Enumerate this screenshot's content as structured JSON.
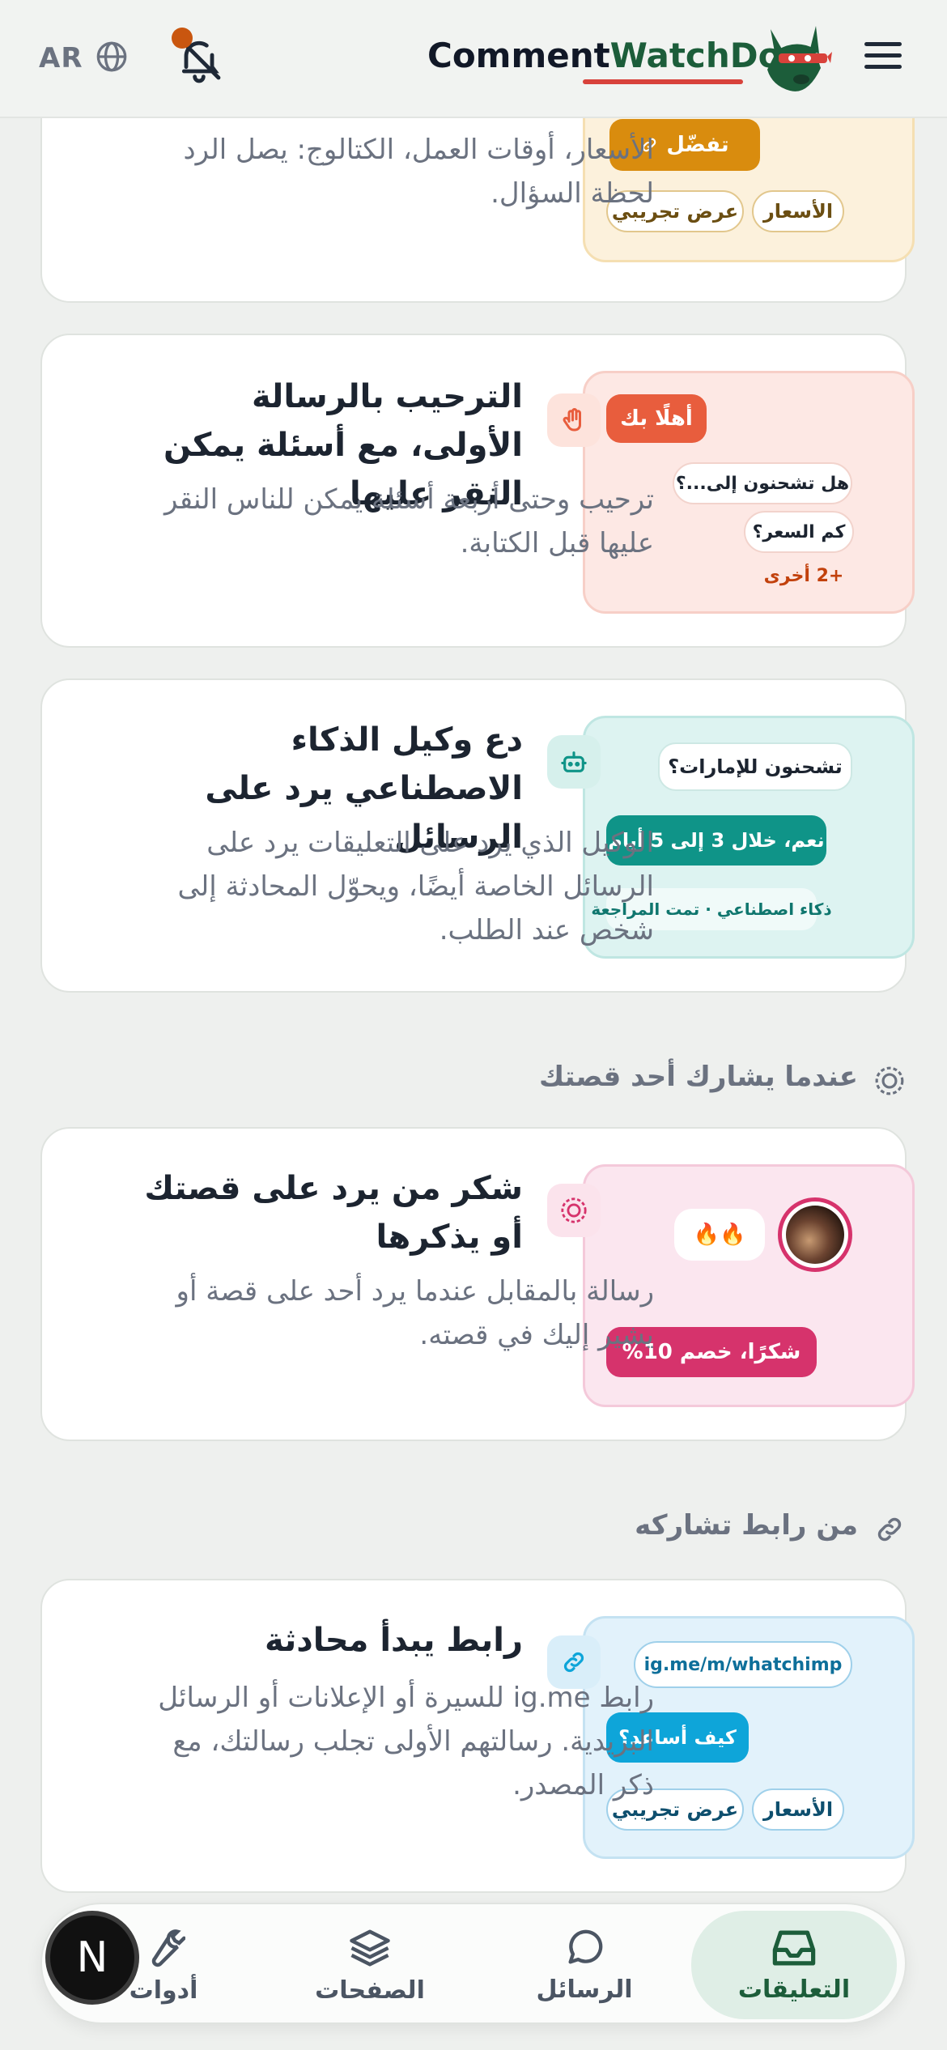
{
  "header": {
    "lang": "AR",
    "brand_part1": "Comment",
    "brand_part2": "WatchDog",
    "colors": {
      "brand_green": "#1c5d3a",
      "underline": "#d8423b",
      "notif_dot": "#c9560f"
    }
  },
  "card0": {
    "desc": "الأسعار، أوقات العمل، الكتالوج: يصل الرد لحظة السؤال.",
    "preview_button": "تفضّل",
    "chip_prices": "الأسعار",
    "chip_demo": "عرض تجريبي"
  },
  "card1": {
    "title": "الترحيب بالرسالة الأولى، مع أسئلة يمكن النقر عليها",
    "desc": "ترحيب وحتى أربعة أسئلة يمكن للناس النقر عليها قبل الكتابة.",
    "bubble_hello": "أهلًا بك",
    "q1": "هل تشحنون إلى...؟",
    "q2": "كم السعر؟",
    "more": "+2 أخرى",
    "icon": "hand-icon"
  },
  "card2": {
    "title": "دع وكيل الذكاء الاصطناعي يرد على الرسائل",
    "desc": "الوكيل الذي يرد على التعليقات يرد على الرسائل الخاصة أيضًا، ويحوّل المحادثة إلى شخص عند الطلب.",
    "q": "تشحنون للإمارات؟",
    "a": "نعم، خلال 3 إلى 5 أيام",
    "tag": "ذكاء اصطناعي · تمت المراجعة",
    "icon": "robot-icon"
  },
  "section_story": {
    "label": "عندما يشارك أحد قصتك",
    "icon": "story-icon"
  },
  "card3": {
    "title": "شكر من يرد على قصتك أو يذكرها",
    "desc": "رسالة بالمقابل عندما يرد أحد على قصة أو يشير إليك في قصته.",
    "reaction": "🔥🔥",
    "reply": "شكرًا، خصم 10%",
    "icon": "story-icon"
  },
  "section_link": {
    "label": "من رابط تشاركه",
    "icon": "link-icon"
  },
  "card4": {
    "title": "رابط يبدأ محادثة",
    "desc": "رابط ig.me للسيرة أو الإعلانات أو الرسائل البريدية. رسالتهم الأولى تجلب رسالتك، مع ذكر المصدر.",
    "link": "ig.me/m/whatchimp",
    "bubble": "كيف أساعد؟",
    "chip_prices": "الأسعار",
    "chip_demo": "عرض تجريبي",
    "icon": "link-icon"
  },
  "nav": {
    "items": [
      {
        "label": "التعليقات",
        "icon": "inbox-icon",
        "active": true
      },
      {
        "label": "الرسائل",
        "icon": "chat-bubble-icon",
        "active": false
      },
      {
        "label": "الصفحات",
        "icon": "layers-icon",
        "active": false
      },
      {
        "label": "أدوات",
        "icon": "wrench-icon",
        "active": false
      }
    ],
    "badge": "N"
  }
}
